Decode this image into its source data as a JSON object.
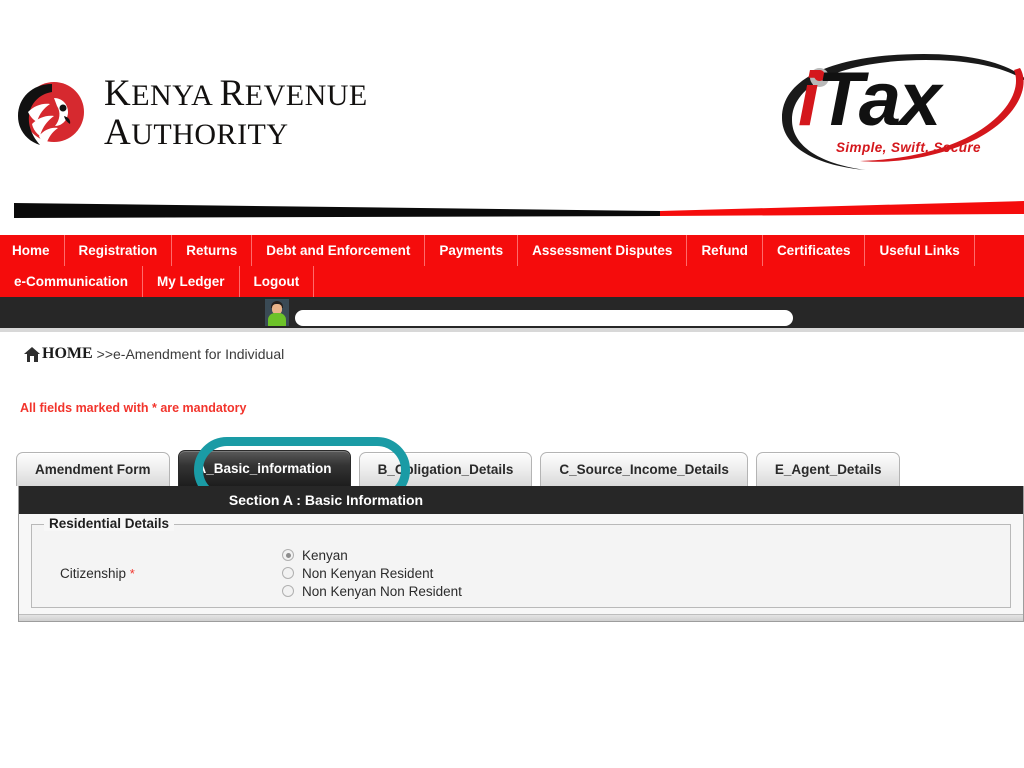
{
  "header": {
    "kra_logo": {
      "line1_cap": "K",
      "line1_rest": "ENYA ",
      "line1_cap2": "R",
      "line1_rest2": "EVENUE",
      "line2_cap": "A",
      "line2_rest": "UTHORITY",
      "icon": "kra-lion-logo"
    },
    "itax_logo": {
      "word_i": "i",
      "word_tax": "Tax",
      "tagline": "Simple, Swift, Secure",
      "icon": "itax-swoosh-logo"
    }
  },
  "nav": {
    "row1": [
      {
        "label": "Home"
      },
      {
        "label": "Registration"
      },
      {
        "label": "Returns"
      },
      {
        "label": "Debt and Enforcement"
      },
      {
        "label": "Payments"
      },
      {
        "label": "Assessment Disputes"
      },
      {
        "label": "Refund"
      },
      {
        "label": "Certificates"
      },
      {
        "label": "Useful Links"
      }
    ],
    "row2": [
      {
        "label": "e-Communication"
      },
      {
        "label": "My Ledger"
      },
      {
        "label": "Logout"
      }
    ]
  },
  "userbar": {
    "avatar_icon": "user-avatar-icon",
    "redacted_value": ""
  },
  "breadcrumb": {
    "home_icon": "home-icon",
    "home_label": "HOME",
    "trail": ">>e-Amendment for Individual"
  },
  "notice": {
    "mandatory_text": "All fields marked with * are mandatory"
  },
  "tabs": [
    {
      "label": "Amendment Form",
      "active": false
    },
    {
      "label": "A_Basic_information",
      "active": true
    },
    {
      "label": "B_Obligation_Details",
      "active": false
    },
    {
      "label": "C_Source_Income_Details",
      "active": false
    },
    {
      "label": "E_Agent_Details",
      "active": false
    }
  ],
  "section": {
    "title": "Section A : Basic Information",
    "fieldset_legend": "Residential Details",
    "field": {
      "label": "Citizenship",
      "required_marker": "*",
      "options": [
        {
          "label": "Kenyan",
          "selected": true
        },
        {
          "label": "Non Kenyan Resident",
          "selected": false
        },
        {
          "label": "Non Kenyan Non Resident",
          "selected": false
        }
      ]
    }
  },
  "colors": {
    "nav_red": "#f50c0c",
    "highlight_teal": "#1a9ba5",
    "section_dark": "#272727",
    "required_red": "#f2342c",
    "itax_red": "#d4171c"
  }
}
